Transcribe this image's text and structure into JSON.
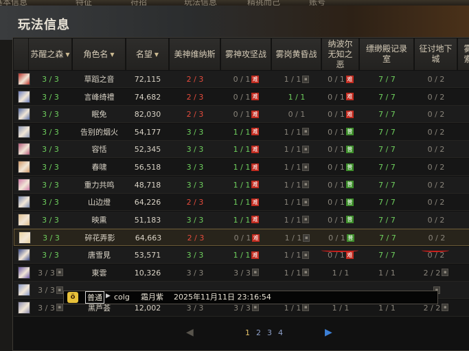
{
  "top_tabs": [
    "基本信息",
    "特征",
    "符招",
    "玩法信息",
    "精挑而己",
    "账号"
  ],
  "page_title": "玩法信息",
  "columns": [
    {
      "label": "苏醒之森",
      "sort": true
    },
    {
      "label": "角色名",
      "sort": true
    },
    {
      "label": "名望",
      "sort": true
    },
    {
      "label": "美神维纳斯",
      "sort": false
    },
    {
      "label": "雾神攻坚战",
      "sort": false
    },
    {
      "label": "雾岗黄昏战",
      "sort": false
    },
    {
      "label": "纳波尔无知之恶",
      "sort": false
    },
    {
      "label": "缥缈殿记录室",
      "sort": false
    },
    {
      "label": "征讨地下城",
      "sort": false
    },
    {
      "label": "雾索",
      "sort": false
    }
  ],
  "rows": [
    {
      "awake": "3 / 3",
      "name": "草蹈之音",
      "fame": "72,115",
      "venus": "2 / 3",
      "venus_c": "red",
      "mist": "0 / 1",
      "mist_b": "hard",
      "dusk": "1 / 1",
      "dusk_b": "lock",
      "nabor": "0 / 1",
      "nabor_b": "hard",
      "record": "7 / 7",
      "dungeon": "0 / 2",
      "avatar": "#b8322b"
    },
    {
      "awake": "3 / 3",
      "name": "言峰绮禮",
      "fame": "74,682",
      "venus": "2 / 3",
      "venus_c": "red",
      "mist": "0 / 1",
      "mist_b": "hard",
      "dusk": "1 / 1",
      "dusk_b": "green",
      "nabor": "0 / 1",
      "nabor_b": "hard",
      "record": "7 / 7",
      "dungeon": "0 / 2",
      "avatar": "#6f7fbf"
    },
    {
      "awake": "3 / 3",
      "name": "眠免",
      "fame": "82,030",
      "venus": "2 / 3",
      "venus_c": "red",
      "mist": "0 / 1",
      "mist_b": "hard",
      "dusk": "0 / 1",
      "dusk_b": "none",
      "nabor": "0 / 1",
      "nabor_b": "hard",
      "record": "7 / 7",
      "dungeon": "0 / 2",
      "avatar": "#5a6fa8"
    },
    {
      "awake": "3 / 3",
      "name": "告别的烟火",
      "fame": "54,177",
      "venus": "3 / 3",
      "venus_c": "green",
      "mist": "1 / 1",
      "mist_b": "hard",
      "dusk": "1 / 1",
      "dusk_b": "lock",
      "nabor": "0 / 1",
      "nabor_b": "norm",
      "record": "7 / 7",
      "dungeon": "0 / 2",
      "avatar": "#8f9ab8"
    },
    {
      "awake": "3 / 3",
      "name": "容恬",
      "fame": "52,345",
      "venus": "3 / 3",
      "venus_c": "green",
      "mist": "1 / 1",
      "mist_b": "hard",
      "dusk": "1 / 1",
      "dusk_b": "lock",
      "nabor": "0 / 1",
      "nabor_b": "norm",
      "record": "7 / 7",
      "dungeon": "0 / 2",
      "avatar": "#b45a7a"
    },
    {
      "awake": "3 / 3",
      "name": "春啸",
      "fame": "56,518",
      "venus": "3 / 3",
      "venus_c": "green",
      "mist": "1 / 1",
      "mist_b": "hard",
      "dusk": "1 / 1",
      "dusk_b": "lock",
      "nabor": "0 / 1",
      "nabor_b": "norm",
      "record": "7 / 7",
      "dungeon": "0 / 2",
      "avatar": "#d09a6a"
    },
    {
      "awake": "3 / 3",
      "name": "重力共鸣",
      "fame": "48,718",
      "venus": "3 / 3",
      "venus_c": "green",
      "mist": "1 / 1",
      "mist_b": "hard",
      "dusk": "1 / 1",
      "dusk_b": "lock",
      "nabor": "0 / 1",
      "nabor_b": "norm",
      "record": "7 / 7",
      "dungeon": "0 / 2",
      "avatar": "#d07aa8"
    },
    {
      "awake": "3 / 3",
      "name": "山边燈",
      "fame": "64,226",
      "venus": "2 / 3",
      "venus_c": "red",
      "mist": "1 / 1",
      "mist_b": "hard",
      "dusk": "1 / 1",
      "dusk_b": "lock",
      "nabor": "0 / 1",
      "nabor_b": "norm",
      "record": "7 / 7",
      "dungeon": "0 / 2",
      "avatar": "#7a8ab0"
    },
    {
      "awake": "3 / 3",
      "name": "映熏",
      "fame": "51,183",
      "venus": "3 / 3",
      "venus_c": "green",
      "mist": "1 / 1",
      "mist_b": "hard",
      "dusk": "1 / 1",
      "dusk_b": "lock",
      "nabor": "0 / 1",
      "nabor_b": "norm",
      "record": "7 / 7",
      "dungeon": "0 / 2",
      "avatar": "#e0c090"
    },
    {
      "awake": "3 / 3",
      "name": "碎花弄影",
      "fame": "64,663",
      "venus": "2 / 3",
      "venus_c": "red",
      "mist": "0 / 1",
      "mist_b": "hard",
      "dusk": "1 / 1",
      "dusk_b": "lock",
      "nabor": "0 / 1",
      "nabor_b": "norm",
      "record": "7 / 7",
      "dungeon": "0 / 2",
      "avatar": "#e8d2a0"
    },
    {
      "awake": "3 / 3",
      "name": "唐雪見",
      "fame": "53,571",
      "venus": "3 / 3",
      "venus_c": "green",
      "mist": "1 / 1",
      "mist_b": "hard",
      "dusk": "1 / 1",
      "dusk_b": "lock",
      "nabor": "0 / 1",
      "nabor_b": "hard",
      "record": "7 / 7",
      "dungeon": "0 / 2",
      "avatar": "#3f4f8f"
    },
    {
      "awake": "3 / 3",
      "name": "東雲",
      "fame": "10,326",
      "venus": "3 / 3",
      "venus_c": "grey",
      "mist": "3 / 3",
      "mist_b": "lock",
      "dusk": "1 / 1",
      "dusk_b": "lock",
      "nabor": "1 / 1",
      "nabor_b": "none",
      "record": "1 / 1",
      "dungeon": "2 / 2",
      "avatar": "#6c5aa8",
      "locked": true
    },
    {
      "awake": "3 / 3",
      "name": "",
      "fame": "",
      "venus": "",
      "venus_c": "grey",
      "mist": "",
      "mist_b": "none",
      "dusk": "",
      "dusk_b": "none",
      "nabor": "",
      "nabor_b": "none",
      "record": "",
      "dungeon": "",
      "avatar": "#8a9ac8",
      "locked": true
    },
    {
      "awake": "3 / 3",
      "name": "黑芦荟",
      "fame": "12,002",
      "venus": "3 / 3",
      "venus_c": "grey",
      "mist": "3 / 3",
      "mist_b": "lock",
      "dusk": "1 / 1",
      "dusk_b": "lock",
      "nabor": "1 / 1",
      "nabor_b": "none",
      "record": "1 / 1",
      "dungeon": "2 / 2",
      "avatar": "#8f8fb0",
      "locked": true
    }
  ],
  "badges": {
    "hard": "难",
    "norm": "普"
  },
  "chat": {
    "channel": "普通",
    "source": "colg",
    "sender": "霜月紫",
    "timestamp": "2025年11月11日 23:16:54"
  },
  "pager": {
    "pages": [
      "1",
      "2",
      "3",
      "4"
    ],
    "current": "1"
  }
}
